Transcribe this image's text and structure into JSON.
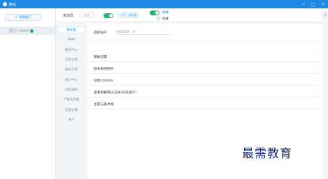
{
  "window": {
    "title": "聊宝",
    "controls": [
      "−",
      "□",
      "×"
    ]
  },
  "sidebar": {
    "add_account_label": "添加账户",
    "add_account_icon": "+",
    "account_chevron": "›"
  },
  "topbar": {
    "search_label": "查询员",
    "search_value": "全部",
    "pill_label": "人气 · 未标签",
    "collect_label": "收藏",
    "expand_label": "续展",
    "edge_tab": "≡"
  },
  "nav": {
    "items": [
      "聊天室",
      "MMB",
      "聊天中心",
      "交际引擎",
      "聊天引擎",
      "统计中心",
      "消息通知",
      "个性化设置",
      "回复设置",
      "关于"
    ]
  },
  "settings": {
    "account_label": "选择账户",
    "account_caret": "⌄",
    "rows": [
      {
        "label": "聊群设置"
      },
      {
        "label": "联系群组服务"
      },
      {
        "label": "获取cookies"
      },
      {
        "label": "查看聊群聊天记录(成员账户)"
      },
      {
        "label": "主题与基本版"
      }
    ],
    "row_chevron": "›"
  },
  "watermark": "最需教育"
}
